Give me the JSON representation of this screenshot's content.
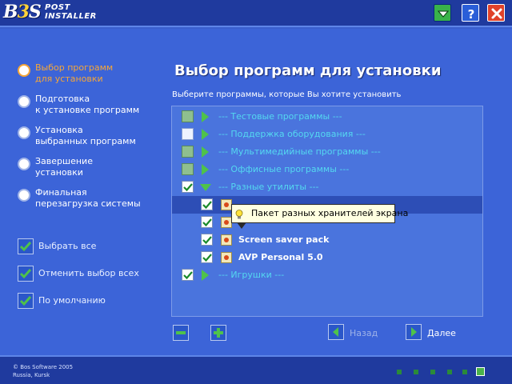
{
  "header": {
    "logo_bs": "BS",
    "logo_line1": "POST",
    "logo_line2": "INSTALLER",
    "buttons": [
      "menu-down-icon",
      "help-icon",
      "close-icon"
    ]
  },
  "steps": [
    {
      "label": "Выбор программ\nдля установки",
      "active": true
    },
    {
      "label": "Подготовка\nк установке программ",
      "active": false
    },
    {
      "label": "Установка\nвыбранных программ",
      "active": false
    },
    {
      "label": "Завершение\nустановки",
      "active": false
    },
    {
      "label": "Финальная\nперезагрузка системы",
      "active": false
    }
  ],
  "left_buttons": [
    {
      "label": "Выбрать все"
    },
    {
      "label": "Отменить выбор всех"
    },
    {
      "label": "По умолчанию"
    }
  ],
  "main": {
    "title": "Выбор программ для установки",
    "subtitle": "Выберите программы, которые Вы хотите установить"
  },
  "list": {
    "rows": [
      {
        "type": "group",
        "label": "--- Тестовые программы ---",
        "check": "grey"
      },
      {
        "type": "group",
        "label": "--- Поддержка оборудования ---",
        "check": "white"
      },
      {
        "type": "group",
        "label": "--- Мультимедийные программы ---",
        "check": "grey"
      },
      {
        "type": "group",
        "label": "--- Оффисные программы ---",
        "check": "grey"
      },
      {
        "type": "group",
        "label": "--- Разные утилиты ---",
        "check": "checked",
        "expanded": true
      },
      {
        "type": "item",
        "label": "",
        "check": "checked",
        "selected": true
      },
      {
        "type": "item",
        "label": "",
        "check": "checked"
      },
      {
        "type": "item",
        "label": "Screen saver pack",
        "check": "checked"
      },
      {
        "type": "item",
        "label": "AVP Personal 5.0",
        "check": "checked"
      },
      {
        "type": "group",
        "label": "--- Игрушки ---",
        "check": "checked"
      }
    ]
  },
  "tooltip": {
    "text": "Пакет разных хранителей экрана"
  },
  "nav": {
    "back": "Назад",
    "next": "Далее"
  },
  "footer": {
    "copyright": "© Bos Software 2005\nRussia, Kursk"
  },
  "colors": {
    "background": "#3a5fcd",
    "header": "#1f3a9e",
    "active_step": "#f5a638",
    "group_text": "#54d8f0",
    "arrow_green": "#4fc24a"
  }
}
